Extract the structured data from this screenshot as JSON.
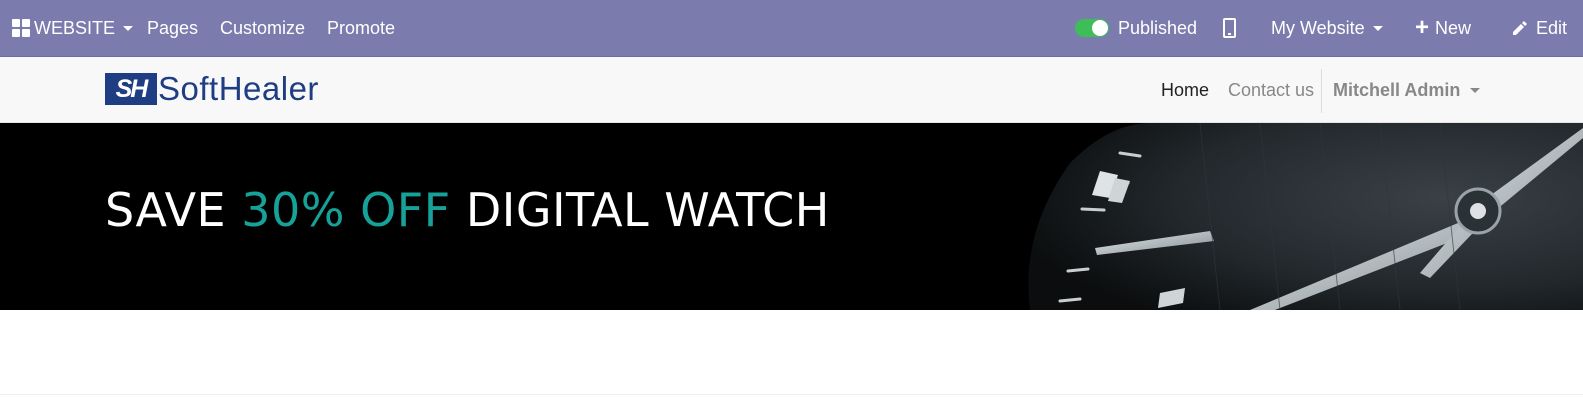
{
  "topbar": {
    "apps_menu_label": "WEBSITE",
    "pages_label": "Pages",
    "customize_label": "Customize",
    "promote_label": "Promote",
    "published_label": "Published",
    "my_website_label": "My Website",
    "new_label": "New",
    "edit_label": "Edit"
  },
  "header": {
    "logo_mark": "SH",
    "logo_text": "SoftHealer",
    "nav": {
      "home": "Home",
      "contact": "Contact us",
      "user": "Mitchell Admin"
    }
  },
  "hero": {
    "title_part1": "SAVE ",
    "title_highlight": "30% OFF",
    "title_part2": " DIGITAL WATCH"
  },
  "colors": {
    "admin_bar": "#7c7bad",
    "brand_blue": "#1f3d82",
    "highlight_teal": "#16a298",
    "toggle_green": "#3dbe58"
  },
  "icons": [
    "apps-grid-icon",
    "mobile-preview-icon",
    "plus-icon",
    "pencil-icon",
    "caret-down-icon"
  ]
}
